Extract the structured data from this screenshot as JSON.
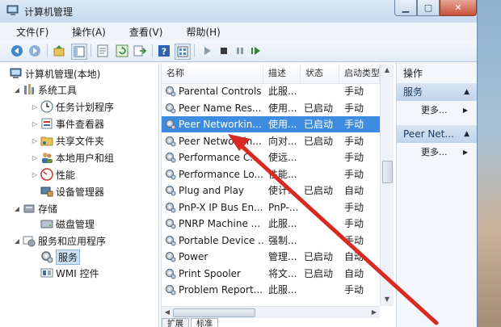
{
  "window": {
    "title": "计算机管理",
    "controls": {
      "minimize": "▁",
      "maximize": "▢",
      "close": "✕"
    }
  },
  "menu": [
    "文件(F)",
    "操作(A)",
    "查看(V)",
    "帮助(H)"
  ],
  "toolbar": [
    "back-icon",
    "forward-icon",
    "up-icon",
    "show-hide-tree-icon",
    "properties-icon",
    "refresh-icon",
    "export-icon",
    "help-icon",
    "view-icon",
    "play-icon",
    "stop-icon",
    "pause-icon",
    "restart-icon"
  ],
  "tree": {
    "root": "计算机管理(本地)",
    "items": [
      {
        "label": "系统工具",
        "icon": "tools-icon"
      },
      {
        "label": "任务计划程序",
        "icon": "clock-icon"
      },
      {
        "label": "事件查看器",
        "icon": "event-viewer-icon"
      },
      {
        "label": "共享文件夹",
        "icon": "shared-folder-icon"
      },
      {
        "label": "本地用户和组",
        "icon": "users-icon"
      },
      {
        "label": "性能",
        "icon": "performance-icon"
      },
      {
        "label": "设备管理器",
        "icon": "device-manager-icon"
      },
      {
        "label": "存储",
        "icon": "storage-icon"
      },
      {
        "label": "磁盘管理",
        "icon": "disk-icon"
      },
      {
        "label": "服务和应用程序",
        "icon": "services-apps-icon"
      },
      {
        "label": "服务",
        "icon": "services-icon"
      },
      {
        "label": "WMI 控件",
        "icon": "wmi-icon"
      }
    ]
  },
  "list": {
    "columns": [
      "名称",
      "描述",
      "状态",
      "启动类型"
    ],
    "rows": [
      {
        "name": "Parental Controls",
        "desc": "此服...",
        "status": "",
        "start": "手动"
      },
      {
        "name": "Peer Name Res...",
        "desc": "使用...",
        "status": "已启动",
        "start": "手动"
      },
      {
        "name": "Peer Networkin...",
        "desc": "使用...",
        "status": "已启动",
        "start": "手动"
      },
      {
        "name": "Peer Networkin...",
        "desc": "向对...",
        "status": "已启动",
        "start": "手动"
      },
      {
        "name": "Performance C...",
        "desc": "使远...",
        "status": "",
        "start": "手动"
      },
      {
        "name": "Performance Lo...",
        "desc": "性能...",
        "status": "",
        "start": "手动"
      },
      {
        "name": "Plug and Play",
        "desc": "使计...",
        "status": "已启动",
        "start": "自动"
      },
      {
        "name": "PnP-X IP Bus En...",
        "desc": "PnP-...",
        "status": "",
        "start": "手动"
      },
      {
        "name": "PNRP Machine ...",
        "desc": "此服...",
        "status": "",
        "start": "手动"
      },
      {
        "name": "Portable Device ...",
        "desc": "强制...",
        "status": "",
        "start": "手动"
      },
      {
        "name": "Power",
        "desc": "管理...",
        "status": "已启动",
        "start": "自动"
      },
      {
        "name": "Print Spooler",
        "desc": "将文...",
        "status": "已启动",
        "start": "自动"
      },
      {
        "name": "Problem Report...",
        "desc": "此服...",
        "status": "",
        "start": "手动"
      }
    ],
    "tabs": [
      "扩展",
      "标准"
    ]
  },
  "actions": {
    "header": "操作",
    "sections": [
      {
        "title": "服务",
        "more": "更多..."
      },
      {
        "title": "Peer Net...",
        "more": "更多..."
      }
    ]
  },
  "colors": {
    "selection": "#3d8ce0",
    "annotation": "#d82a22"
  }
}
